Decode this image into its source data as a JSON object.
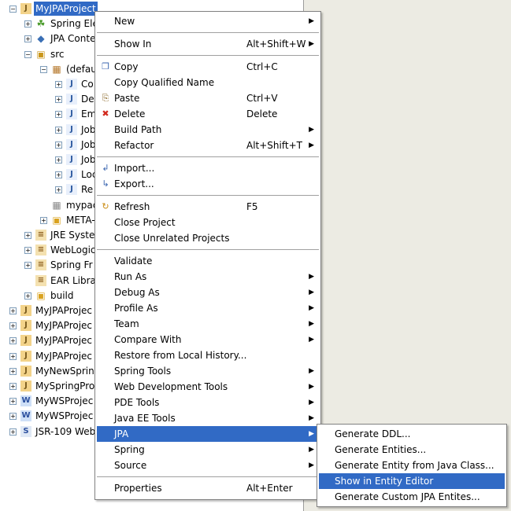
{
  "tree": {
    "items": [
      {
        "label": "MyJPAProject",
        "indent": 0,
        "expander": "-",
        "icon": "java-project-icon",
        "selected": true
      },
      {
        "label": "Spring Ele",
        "indent": 1,
        "expander": "+",
        "icon": "spring-leaf-icon"
      },
      {
        "label": "JPA Conte",
        "indent": 1,
        "expander": "+",
        "icon": "jpa-content-icon"
      },
      {
        "label": "src",
        "indent": 1,
        "expander": "-",
        "icon": "source-folder-icon"
      },
      {
        "label": "(defau",
        "indent": 2,
        "expander": "-",
        "icon": "package-icon"
      },
      {
        "label": "Co",
        "indent": 3,
        "expander": "+",
        "icon": "java-file-icon"
      },
      {
        "label": "De",
        "indent": 3,
        "expander": "+",
        "icon": "java-file-icon"
      },
      {
        "label": "Em",
        "indent": 3,
        "expander": "+",
        "icon": "java-file-icon"
      },
      {
        "label": "Job",
        "indent": 3,
        "expander": "+",
        "icon": "java-file-icon"
      },
      {
        "label": "Job",
        "indent": 3,
        "expander": "+",
        "icon": "java-file-icon"
      },
      {
        "label": "Job",
        "indent": 3,
        "expander": "+",
        "icon": "java-file-icon"
      },
      {
        "label": "Loc",
        "indent": 3,
        "expander": "+",
        "icon": "java-file-icon"
      },
      {
        "label": "Re",
        "indent": 3,
        "expander": "+",
        "icon": "java-file-icon"
      },
      {
        "label": "mypac",
        "indent": 2,
        "expander": "",
        "icon": "empty-package-icon"
      },
      {
        "label": "META-",
        "indent": 2,
        "expander": "+",
        "icon": "folder-icon"
      },
      {
        "label": "JRE Syste",
        "indent": 1,
        "expander": "+",
        "icon": "library-icon"
      },
      {
        "label": "WebLogic",
        "indent": 1,
        "expander": "+",
        "icon": "library-icon"
      },
      {
        "label": "Spring Fr",
        "indent": 1,
        "expander": "+",
        "icon": "library-icon"
      },
      {
        "label": "EAR Libra",
        "indent": 1,
        "expander": "",
        "icon": "library-icon"
      },
      {
        "label": "build",
        "indent": 1,
        "expander": "+",
        "icon": "folder-icon"
      },
      {
        "label": "MyJPAProjec",
        "indent": 0,
        "expander": "+",
        "icon": "java-project-icon"
      },
      {
        "label": "MyJPAProjec",
        "indent": 0,
        "expander": "+",
        "icon": "java-project-icon"
      },
      {
        "label": "MyJPAProjec",
        "indent": 0,
        "expander": "+",
        "icon": "java-project-icon"
      },
      {
        "label": "MyJPAProjec",
        "indent": 0,
        "expander": "+",
        "icon": "java-project-icon"
      },
      {
        "label": "MyNewSprin",
        "indent": 0,
        "expander": "+",
        "icon": "java-project-icon"
      },
      {
        "label": "MySpringPro",
        "indent": 0,
        "expander": "+",
        "icon": "java-project-icon"
      },
      {
        "label": "MyWSProjec",
        "indent": 0,
        "expander": "+",
        "icon": "web-project-icon"
      },
      {
        "label": "MyWSProjec",
        "indent": 0,
        "expander": "+",
        "icon": "web-project-icon"
      },
      {
        "label": "JSR-109 Web",
        "indent": 0,
        "expander": "+",
        "icon": "webservice-project-icon"
      }
    ]
  },
  "context_menu": {
    "items": [
      {
        "type": "item",
        "label": "New",
        "shortcut": "",
        "submenu": true,
        "icon": ""
      },
      {
        "type": "sep"
      },
      {
        "type": "item",
        "label": "Show In",
        "shortcut": "Alt+Shift+W",
        "submenu": true,
        "icon": ""
      },
      {
        "type": "sep"
      },
      {
        "type": "item",
        "label": "Copy",
        "shortcut": "Ctrl+C",
        "submenu": false,
        "icon": "copy-icon"
      },
      {
        "type": "item",
        "label": "Copy Qualified Name",
        "shortcut": "",
        "submenu": false,
        "icon": ""
      },
      {
        "type": "item",
        "label": "Paste",
        "shortcut": "Ctrl+V",
        "submenu": false,
        "icon": "paste-icon"
      },
      {
        "type": "item",
        "label": "Delete",
        "shortcut": "Delete",
        "submenu": false,
        "icon": "delete-icon"
      },
      {
        "type": "item",
        "label": "Build Path",
        "shortcut": "",
        "submenu": true,
        "icon": ""
      },
      {
        "type": "item",
        "label": "Refactor",
        "shortcut": "Alt+Shift+T",
        "submenu": true,
        "icon": ""
      },
      {
        "type": "sep"
      },
      {
        "type": "item",
        "label": "Import...",
        "shortcut": "",
        "submenu": false,
        "icon": "import-icon"
      },
      {
        "type": "item",
        "label": "Export...",
        "shortcut": "",
        "submenu": false,
        "icon": "export-icon"
      },
      {
        "type": "sep"
      },
      {
        "type": "item",
        "label": "Refresh",
        "shortcut": "F5",
        "submenu": false,
        "icon": "refresh-icon"
      },
      {
        "type": "item",
        "label": "Close Project",
        "shortcut": "",
        "submenu": false,
        "icon": ""
      },
      {
        "type": "item",
        "label": "Close Unrelated Projects",
        "shortcut": "",
        "submenu": false,
        "icon": ""
      },
      {
        "type": "sep"
      },
      {
        "type": "item",
        "label": "Validate",
        "shortcut": "",
        "submenu": false,
        "icon": ""
      },
      {
        "type": "item",
        "label": "Run As",
        "shortcut": "",
        "submenu": true,
        "icon": ""
      },
      {
        "type": "item",
        "label": "Debug As",
        "shortcut": "",
        "submenu": true,
        "icon": ""
      },
      {
        "type": "item",
        "label": "Profile As",
        "shortcut": "",
        "submenu": true,
        "icon": ""
      },
      {
        "type": "item",
        "label": "Team",
        "shortcut": "",
        "submenu": true,
        "icon": ""
      },
      {
        "type": "item",
        "label": "Compare With",
        "shortcut": "",
        "submenu": true,
        "icon": ""
      },
      {
        "type": "item",
        "label": "Restore from Local History...",
        "shortcut": "",
        "submenu": false,
        "icon": ""
      },
      {
        "type": "item",
        "label": "Spring Tools",
        "shortcut": "",
        "submenu": true,
        "icon": ""
      },
      {
        "type": "item",
        "label": "Web Development Tools",
        "shortcut": "",
        "submenu": true,
        "icon": ""
      },
      {
        "type": "item",
        "label": "PDE Tools",
        "shortcut": "",
        "submenu": true,
        "icon": ""
      },
      {
        "type": "item",
        "label": "Java EE Tools",
        "shortcut": "",
        "submenu": true,
        "icon": ""
      },
      {
        "type": "item",
        "label": "JPA",
        "shortcut": "",
        "submenu": true,
        "icon": "",
        "highlight": true
      },
      {
        "type": "item",
        "label": "Spring",
        "shortcut": "",
        "submenu": true,
        "icon": ""
      },
      {
        "type": "item",
        "label": "Source",
        "shortcut": "",
        "submenu": true,
        "icon": ""
      },
      {
        "type": "sep"
      },
      {
        "type": "item",
        "label": "Properties",
        "shortcut": "Alt+Enter",
        "submenu": false,
        "icon": ""
      }
    ]
  },
  "jpa_submenu": {
    "items": [
      {
        "label": "Generate DDL..."
      },
      {
        "label": "Generate Entities..."
      },
      {
        "label": "Generate Entity from Java Class..."
      },
      {
        "label": "Show in Entity Editor",
        "highlight": true
      },
      {
        "label": "Generate Custom JPA Entites..."
      }
    ]
  },
  "colors": {
    "selection": "#316ac5",
    "menu_bg": "#ffffff",
    "pane_bg": "#ecebe3"
  }
}
